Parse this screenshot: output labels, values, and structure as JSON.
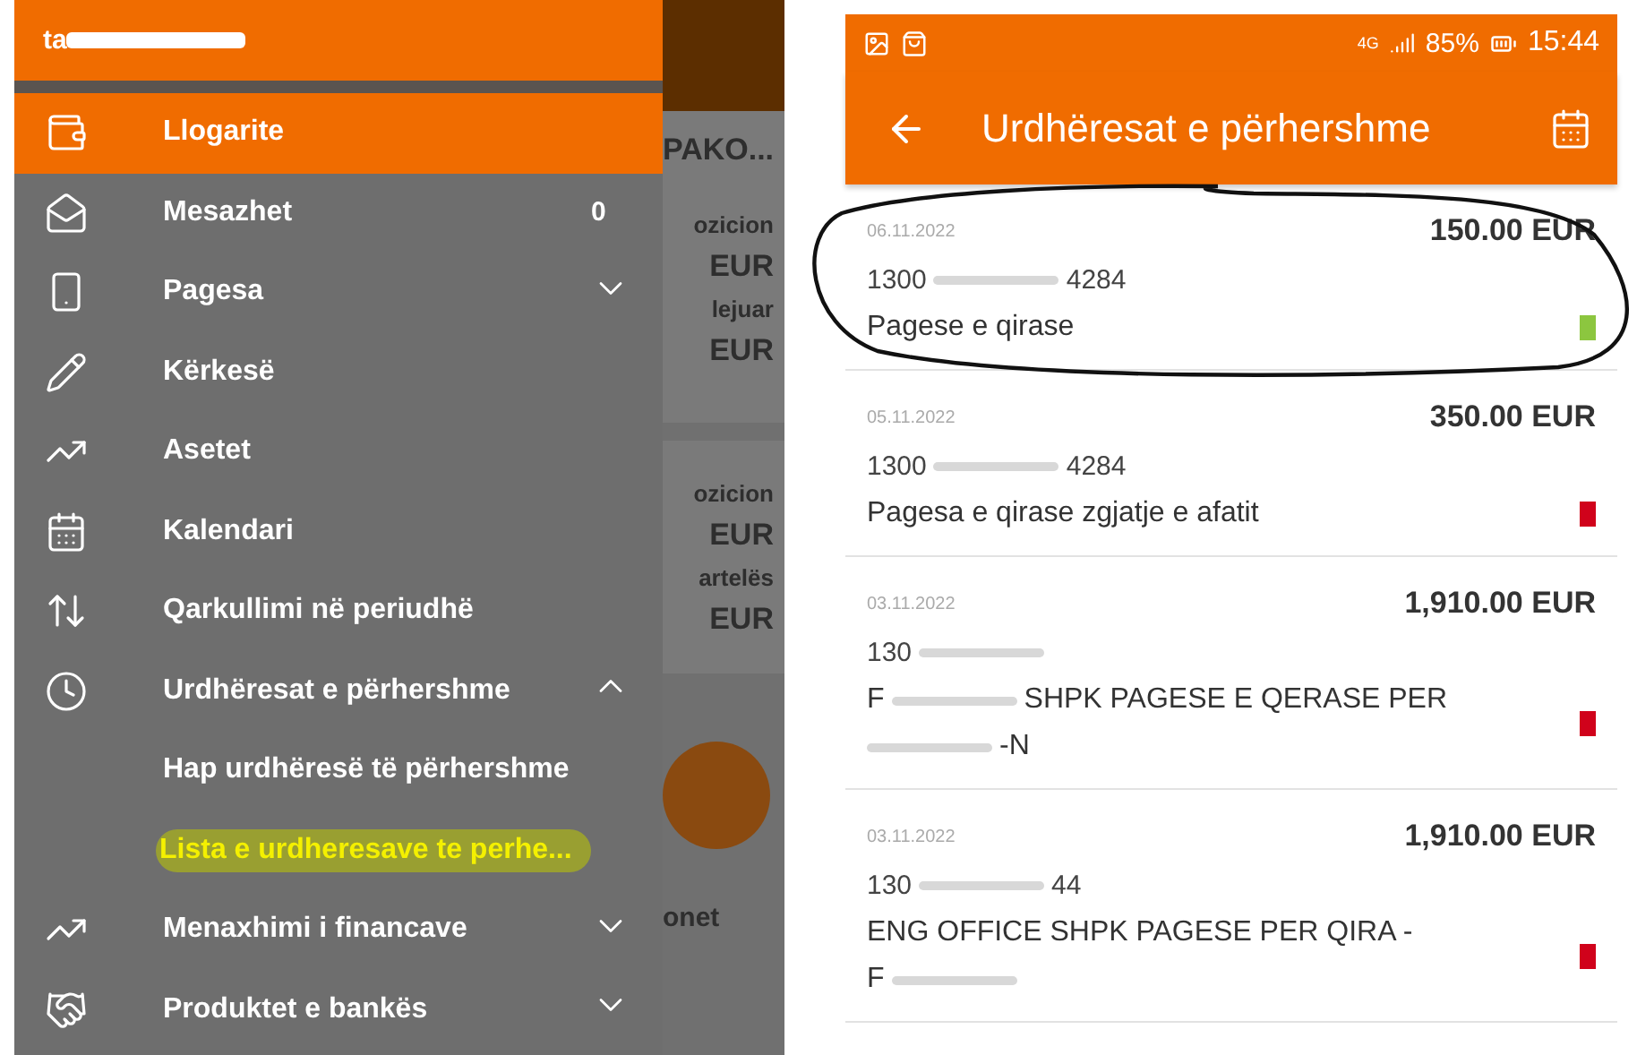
{
  "drawer": {
    "user": "ta",
    "items": [
      {
        "kind": "item",
        "label": "Llogarite",
        "selected": true,
        "highlighted": false
      },
      {
        "kind": "item",
        "label": "Mesazhet",
        "badge": "0",
        "selected": false,
        "highlighted": false
      },
      {
        "kind": "item",
        "label": "Pagesa",
        "expanded": false,
        "selected": false,
        "highlighted": false
      },
      {
        "kind": "item",
        "label": "Kërkesë",
        "selected": false,
        "highlighted": false
      },
      {
        "kind": "item",
        "label": "Asetet",
        "selected": false,
        "highlighted": false
      },
      {
        "kind": "item",
        "label": "Kalendari",
        "selected": false,
        "highlighted": false
      },
      {
        "kind": "item",
        "label": "Qarkullimi në periudhë",
        "selected": false,
        "highlighted": false
      },
      {
        "kind": "item",
        "label": "Urdhëresat e përhershme",
        "expanded": true,
        "selected": false,
        "highlighted": false
      },
      {
        "kind": "subitem",
        "label": "Hap urdhëresë të përhershme",
        "selected": false,
        "highlighted": false
      },
      {
        "kind": "subitem",
        "label": "Lista e urdheresave te perhe...",
        "selected": false,
        "highlighted": true
      },
      {
        "kind": "item",
        "label": "Menaxhimi i financave",
        "expanded": false,
        "selected": false,
        "highlighted": false
      },
      {
        "kind": "item",
        "label": "Produktet e bankës",
        "expanded": false,
        "selected": false,
        "highlighted": false
      }
    ]
  },
  "background": {
    "title": "PAKO...",
    "cards": [
      {
        "lines": [
          {
            "kind": "label",
            "text": "ozicion"
          },
          {
            "kind": "amount",
            "text": "EUR"
          },
          {
            "kind": "label",
            "text": "lejuar"
          },
          {
            "kind": "amount",
            "text": "EUR"
          }
        ]
      },
      {
        "lines": [
          {
            "kind": "label",
            "text": "ozicion"
          },
          {
            "kind": "amount",
            "text": "EUR"
          },
          {
            "kind": "label",
            "text": "artelës"
          },
          {
            "kind": "amount",
            "text": "EUR"
          }
        ]
      }
    ],
    "shortcut_label": "onet"
  },
  "status_bar": {
    "network": "4G",
    "battery": "85%",
    "time": "15:44"
  },
  "app_bar": {
    "title": "Urdhëresat e përhershme"
  },
  "orders": [
    {
      "date": "06.11.2022",
      "amount": "150.00 EUR",
      "account": [
        {
          "kind": "text",
          "text": "1300"
        },
        {
          "kind": "redacted"
        },
        {
          "kind": "text",
          "text": "4284"
        }
      ],
      "description": [
        [
          {
            "kind": "text",
            "text": "Pagese e qirase"
          }
        ]
      ],
      "color": "#8cc63f",
      "circled": true
    },
    {
      "date": "05.11.2022",
      "amount": "350.00 EUR",
      "account": [
        {
          "kind": "text",
          "text": "1300"
        },
        {
          "kind": "redacted"
        },
        {
          "kind": "text",
          "text": "4284"
        }
      ],
      "description": [
        [
          {
            "kind": "text",
            "text": "Pagesa e qirase zgjatje e afatit"
          }
        ]
      ],
      "color": "#d0021b",
      "circled": false
    },
    {
      "date": "03.11.2022",
      "amount": "1,910.00 EUR",
      "account": [
        {
          "kind": "text",
          "text": "130"
        },
        {
          "kind": "redacted"
        }
      ],
      "description": [
        [
          {
            "kind": "text",
            "text": "F"
          },
          {
            "kind": "redacted"
          },
          {
            "kind": "text",
            "text": "SHPK PAGESE E QERASE PER"
          }
        ],
        [
          {
            "kind": "redacted"
          },
          {
            "kind": "text",
            "text": "-N"
          }
        ]
      ],
      "color": "#d0021b",
      "circled": false
    },
    {
      "date": "03.11.2022",
      "amount": "1,910.00 EUR",
      "account": [
        {
          "kind": "text",
          "text": "130"
        },
        {
          "kind": "redacted"
        },
        {
          "kind": "text",
          "text": "44"
        }
      ],
      "description": [
        [
          {
            "kind": "text",
            "text": "ENG OFFICE SHPK PAGESE PER QIRA -"
          }
        ],
        [
          {
            "kind": "text",
            "text": "F"
          },
          {
            "kind": "redacted"
          }
        ]
      ],
      "color": "#d0021b",
      "circled": false
    }
  ]
}
